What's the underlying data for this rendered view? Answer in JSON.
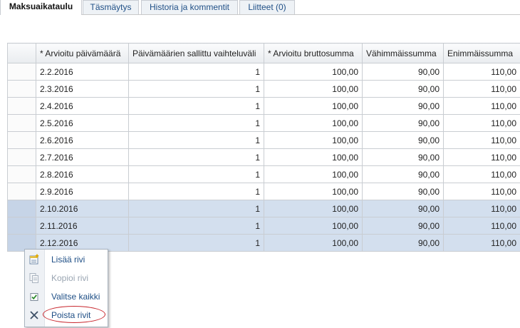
{
  "tabs": [
    {
      "label": "Maksuaikataulu",
      "active": true
    },
    {
      "label": "Täsmäytys",
      "active": false
    },
    {
      "label": "Historia ja kommentit",
      "active": false
    },
    {
      "label": "Liitteet (0)",
      "active": false
    }
  ],
  "grid": {
    "columns": [
      "",
      "* Arvioitu päivämäärä",
      "Päivämäärien sallittu vaihteluväli",
      "* Arvioitu bruttosumma",
      "Vähimmäissumma",
      "Enimmäissumma"
    ],
    "rows": [
      {
        "date": "2.2.2016",
        "tolerance": "1",
        "gross": "100,00",
        "min": "90,00",
        "max": "110,00",
        "selected": false
      },
      {
        "date": "2.3.2016",
        "tolerance": "1",
        "gross": "100,00",
        "min": "90,00",
        "max": "110,00",
        "selected": false
      },
      {
        "date": "2.4.2016",
        "tolerance": "1",
        "gross": "100,00",
        "min": "90,00",
        "max": "110,00",
        "selected": false
      },
      {
        "date": "2.5.2016",
        "tolerance": "1",
        "gross": "100,00",
        "min": "90,00",
        "max": "110,00",
        "selected": false
      },
      {
        "date": "2.6.2016",
        "tolerance": "1",
        "gross": "100,00",
        "min": "90,00",
        "max": "110,00",
        "selected": false
      },
      {
        "date": "2.7.2016",
        "tolerance": "1",
        "gross": "100,00",
        "min": "90,00",
        "max": "110,00",
        "selected": false
      },
      {
        "date": "2.8.2016",
        "tolerance": "1",
        "gross": "100,00",
        "min": "90,00",
        "max": "110,00",
        "selected": false
      },
      {
        "date": "2.9.2016",
        "tolerance": "1",
        "gross": "100,00",
        "min": "90,00",
        "max": "110,00",
        "selected": false
      },
      {
        "date": "2.10.2016",
        "tolerance": "1",
        "gross": "100,00",
        "min": "90,00",
        "max": "110,00",
        "selected": true
      },
      {
        "date": "2.11.2016",
        "tolerance": "1",
        "gross": "100,00",
        "min": "90,00",
        "max": "110,00",
        "selected": true
      },
      {
        "date": "2.12.2016",
        "tolerance": "1",
        "gross": "100,00",
        "min": "90,00",
        "max": "110,00",
        "selected": true
      }
    ]
  },
  "context_menu": {
    "items": [
      {
        "label": "Lisää rivi",
        "icon": "add-row-icon",
        "disabled": false
      },
      {
        "label": "Kopioi rivi",
        "icon": "copy-icon",
        "disabled": true
      },
      {
        "label": "Valitse kaikki",
        "icon": "checkbox-checked-icon",
        "disabled": false
      },
      {
        "label": "Poista rivit",
        "icon": "delete-x-icon",
        "disabled": false
      }
    ]
  },
  "colors": {
    "link_text": "#1f4f86",
    "selected_row": "#d3dfee",
    "highlight_ellipse": "#c8272e"
  }
}
